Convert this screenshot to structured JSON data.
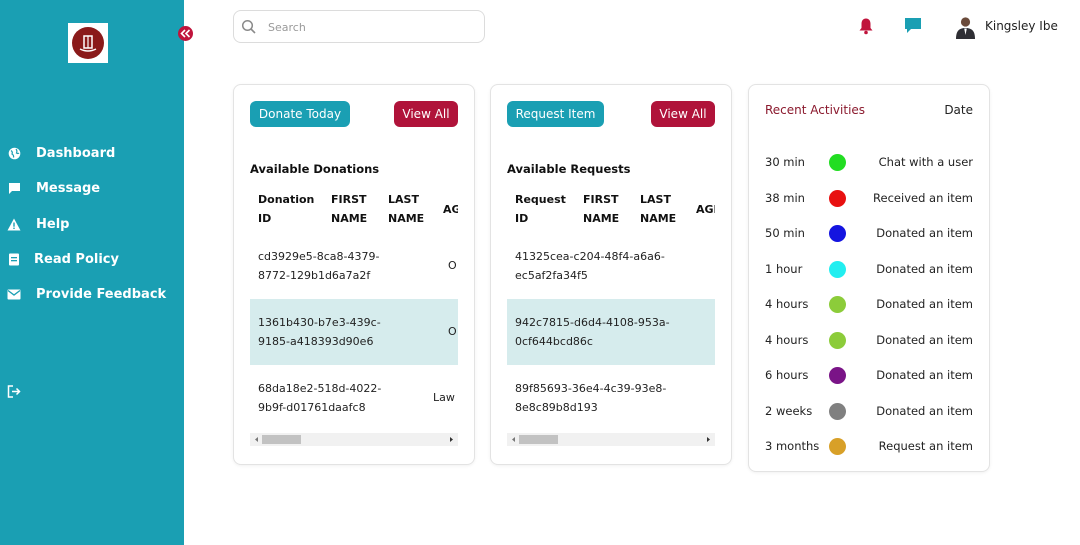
{
  "user": {
    "name": "Kingsley Ibe"
  },
  "search": {
    "placeholder": "Search"
  },
  "sidebar": {
    "items": [
      {
        "label": "Dashboard",
        "icon": "globe-icon"
      },
      {
        "label": "Message",
        "icon": "message-icon"
      },
      {
        "label": "Help",
        "icon": "warning-icon"
      },
      {
        "label": "Read Policy",
        "icon": "document-icon"
      },
      {
        "label": "Provide Feedback",
        "icon": "mail-icon"
      }
    ],
    "logout_icon": "logout-icon"
  },
  "donations": {
    "primary_button": "Donate Today",
    "view_all": "View All",
    "title": "Available Donations",
    "columns": [
      "Donation ID",
      "FIRST NAME",
      "LAST NAME",
      "AG"
    ],
    "rows": [
      {
        "id": "cd3929e5-8ca8-4379-8772-129b1d6a7a2f",
        "extra": "O"
      },
      {
        "id": "1361b430-b7e3-439c-9185-a418393d90e6",
        "extra": "O"
      },
      {
        "id": "68da18e2-518d-4022-9b9f-d01761daafc8",
        "extra": "Law"
      }
    ]
  },
  "requests": {
    "primary_button": "Request Item",
    "view_all": "View All",
    "title": "Available Requests",
    "columns": [
      "Request ID",
      "FIRST NAME",
      "LAST NAME",
      "AGI"
    ],
    "rows": [
      {
        "id": "41325cea-c204-48f4-a6a6-ec5af2fa34f5"
      },
      {
        "id": "942c7815-d6d4-4108-953a-0cf644bcd86c"
      },
      {
        "id": "89f85693-36e4-4c39-93e8-8e8c89b8d193"
      }
    ]
  },
  "activities": {
    "title": "Recent Activities",
    "date_label": "Date",
    "items": [
      {
        "time": "30 min",
        "color": "#22dd22",
        "description": "Chat with a user"
      },
      {
        "time": "38 min",
        "color": "#e81010",
        "description": "Received an item"
      },
      {
        "time": "50 min",
        "color": "#1414e0",
        "description": "Donated an item"
      },
      {
        "time": "1 hour",
        "color": "#22eef0",
        "description": "Donated an item"
      },
      {
        "time": "4 hours",
        "color": "#8ccc3a",
        "description": "Donated an item"
      },
      {
        "time": "4 hours",
        "color": "#8ccc3a",
        "description": "Donated an item"
      },
      {
        "time": "6 hours",
        "color": "#7a1487",
        "description": "Donated an item"
      },
      {
        "time": "2 weeks",
        "color": "#808080",
        "description": "Donated an item"
      },
      {
        "time": "3 months",
        "color": "#d8a028",
        "description": "Request an item"
      }
    ]
  },
  "colors": {
    "sidebar": "#1a9fb3",
    "accent_red": "#b0133a",
    "highlight_row": "#d6eced",
    "activities_title": "#8b1a2e"
  }
}
